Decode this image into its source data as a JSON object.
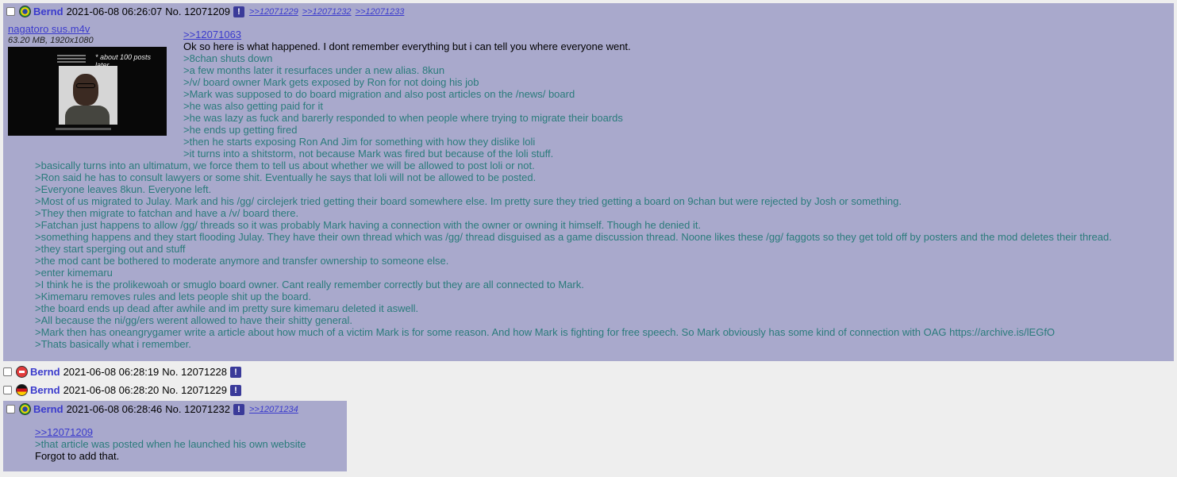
{
  "posts": [
    {
      "name": "Bernd",
      "date": "2021-06-08 06:26:07",
      "no": "No. 12071209",
      "report": "!",
      "flag": "brazil-flag-icon",
      "backlinks": [
        ">>12071229",
        ">>12071232",
        ">>12071233"
      ],
      "file": {
        "name": "nagatoro sus.m4v",
        "info": "63.20 MB, 1920x1080",
        "thumb_caption": "* about 100 posts later..."
      },
      "reply_to": ">>12071063",
      "lines": [
        {
          "t": "Ok so here is what happened. I dont remember everything but i can tell you where everyone went.",
          "q": false
        },
        {
          "t": ">8chan shuts down",
          "q": true
        },
        {
          "t": ">a few months later it resurfaces under a new alias. 8kun",
          "q": true
        },
        {
          "t": ">/v/ board owner Mark gets exposed by Ron for not doing his job",
          "q": true
        },
        {
          "t": ">Mark was supposed to do board migration and also post articles on the /news/ board",
          "q": true
        },
        {
          "t": ">he was also getting paid for it",
          "q": true
        },
        {
          "t": ">he was lazy as fuck and barerly responded to when people where trying to migrate their boards",
          "q": true
        },
        {
          "t": ">he ends up getting fired",
          "q": true
        },
        {
          "t": ">then he starts exposing Ron And Jim for something with how they dislike loli",
          "q": true
        },
        {
          "t": ">it turns into a shitstorm, not because Mark was fired but because of the loli stuff.",
          "q": true
        },
        {
          "t": ">basically turns into an ultimatum, we force them to tell us about whether we will be allowed to post loli or not.",
          "q": true
        },
        {
          "t": ">Ron said he has to consult lawyers or some shit. Eventually he says that loli will not be allowed to be posted.",
          "q": true
        },
        {
          "t": ">Everyone leaves 8kun. Everyone left.",
          "q": true
        },
        {
          "t": ">Most of us migrated to Julay. Mark and his /gg/ circlejerk tried getting their board somewhere else. Im pretty sure they tried getting a board on 9chan but were rejected by Josh or something.",
          "q": true
        },
        {
          "t": ">They then migrate to fatchan and have a /v/ board there.",
          "q": true
        },
        {
          "t": ">Fatchan just happens to allow /gg/ threads so it was probably Mark having a connection with the owner or owning it himself. Though he denied it.",
          "q": true
        },
        {
          "t": ">something happens and they start flooding Julay. They have their own thread which was /gg/ thread disguised as a game discussion thread. Noone likes these /gg/ faggots so they get told off by posters and the mod deletes their thread.",
          "q": true
        },
        {
          "t": ">they start sperging out and stuff",
          "q": true
        },
        {
          "t": ">the mod cant be bothered to moderate anymore and transfer ownership to someone else.",
          "q": true
        },
        {
          "t": ">enter kimemaru",
          "q": true
        },
        {
          "t": ">I think he is the prolikewoah or smuglo board owner. Cant really remember correctly but they are all connected to Mark.",
          "q": true
        },
        {
          "t": ">Kimemaru removes rules and lets people shit up the board.",
          "q": true
        },
        {
          "t": ">the board ends up dead after awhile and im pretty sure kimemaru deleted it aswell.",
          "q": true
        },
        {
          "t": ">All because the ni/gg/ers werent allowed to have their shitty general.",
          "q": true
        },
        {
          "t": ">Mark then has oneangrygamer write a article about how much of a victim Mark is for some reason. And how Mark is fighting for free speech. So Mark obviously has some kind of connection with OAG https://archive.is/lEGfO",
          "q": true
        },
        {
          "t": ">Thats basically what i remember.",
          "q": true
        }
      ]
    },
    {
      "name": "Bernd",
      "date": "2021-06-08 06:28:19",
      "no": "No. 12071228",
      "report": "!",
      "flag": "switzerland-flag-icon"
    },
    {
      "name": "Bernd",
      "date": "2021-06-08 06:28:20",
      "no": "No. 12071229",
      "report": "!",
      "flag": "germany-flag-icon"
    },
    {
      "name": "Bernd",
      "date": "2021-06-08 06:28:46",
      "no": "No. 12071232",
      "report": "!",
      "flag": "brazil-flag-icon",
      "backlinks": [
        ">>12071234"
      ],
      "reply_to": ">>12071209",
      "lines": [
        {
          "t": ">that article was posted when he launched his own website",
          "q": true
        },
        {
          "t": "Forgot to add that.",
          "q": false
        }
      ]
    }
  ]
}
